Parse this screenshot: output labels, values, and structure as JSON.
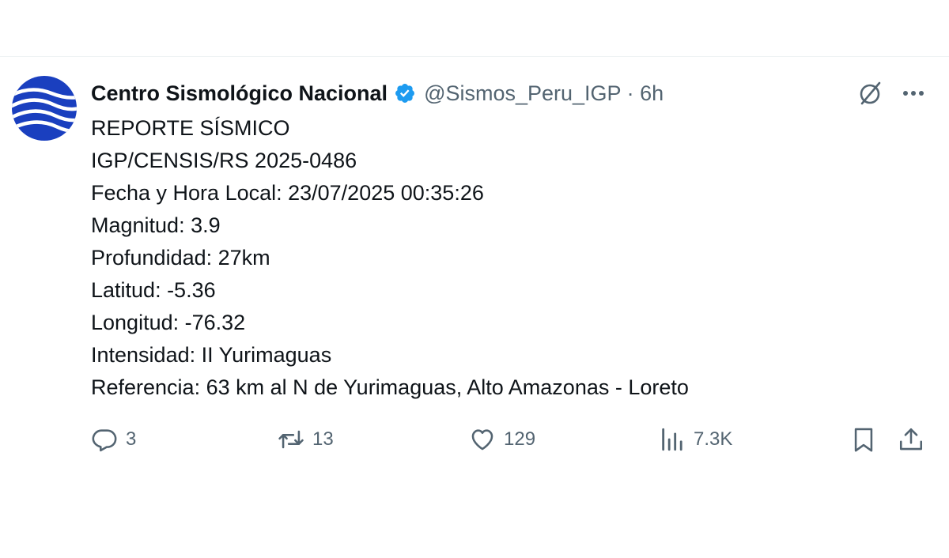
{
  "tweet": {
    "author_name": "Centro Sismológico Nacional",
    "handle_time": "@Sismos_Peru_IGP · 6h",
    "lines": [
      "REPORTE SÍSMICO",
      "IGP/CENSIS/RS 2025-0486",
      "Fecha y Hora Local: 23/07/2025 00:35:26",
      "Magnitud: 3.9",
      "Profundidad: 27km",
      "Latitud: -5.36",
      "Longitud: -76.32",
      "Intensidad: II Yurimaguas",
      "Referencia: 63 km al N de Yurimaguas, Alto Amazonas - Loreto"
    ]
  },
  "actions": {
    "replies": "3",
    "reposts": "13",
    "likes": "129",
    "views": "7.3K"
  },
  "icons": {
    "avatar": "seismic-logo",
    "verified": "verified-badge-icon",
    "grok": "grok-icon",
    "more": "more-icon",
    "reply": "reply-icon",
    "repost": "repost-icon",
    "like": "like-icon",
    "views": "views-icon",
    "bookmark": "bookmark-icon",
    "share": "share-icon"
  },
  "colors": {
    "text": "#0f1419",
    "muted": "#536471",
    "verified": "#1d9bf0",
    "logo_blue": "#1a3fbf"
  }
}
